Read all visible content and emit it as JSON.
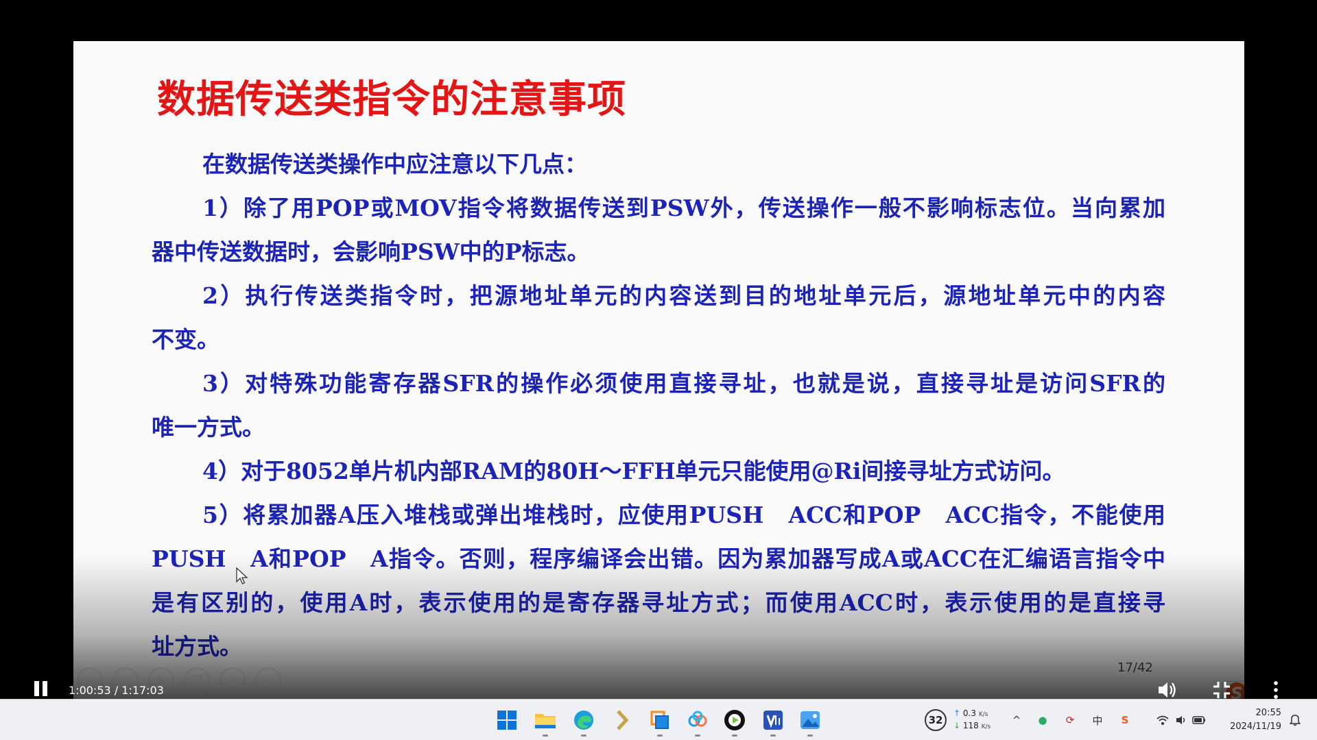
{
  "slide": {
    "title": "数据传送类指令的注意事项",
    "lines": [
      "在数据传送类操作中应注意以下几点：",
      "1）除了用POP或MOV指令将数据传送到PSW外，传送操作一般不影响标志位。当向累加",
      "器中传送数据时，会影响PSW中的P标志。",
      "2）执行传送类指令时，把源地址单元的内容送到目的地址单元后，源地址单元中的内容",
      "不变。",
      "3）对特殊功能寄存器SFR的操作必须使用直接寻址，也就是说，直接寻址是访问SFR的",
      "唯一方式。",
      "4）对于8052单片机内部RAM的80H～FFH单元只能使用@Ri间接寻址方式访问。",
      "5）将累加器A压入堆栈或弹出堆栈时，应使用PUSH　ACC和POP　ACC指令，不能使用",
      "PUSH　A和POP　A指令。否则，程序编译会出错。因为累加器写成A或ACC在汇编语言指令中",
      "是有区别的，使用A时，表示使用的是寄存器寻址方式；而使用ACC时，表示使用的是直接寻",
      "址方式。"
    ],
    "page_indicator": "17/42",
    "text_color": "#1c23b7",
    "title_color": "#e41515"
  },
  "ime": {
    "logo": "S",
    "mode": "中",
    "punct": "°,"
  },
  "player": {
    "time": "1:00:53 / 1:17:03",
    "state_icon": "pause-icon",
    "toolbar_icons": [
      "arrow-left-icon",
      "arrow-right-icon",
      "pen-icon",
      "copy-icon",
      "zoom-icon",
      "menu-icon"
    ]
  },
  "taskbar": {
    "apps": [
      "windows-start-icon",
      "file-explorer-icon",
      "edge-icon",
      "kingsoft-icon",
      "task-view-icon",
      "baidu-netdisk-icon",
      "video-app-icon",
      "vs-icon",
      "photos-icon"
    ],
    "weather_temp": "32",
    "net_up": "0.3",
    "net_up_unit": "K/s",
    "net_down": "118",
    "net_down_unit": "K/s",
    "input_method": "中",
    "time": "20:55",
    "date": "2024/11/19"
  }
}
